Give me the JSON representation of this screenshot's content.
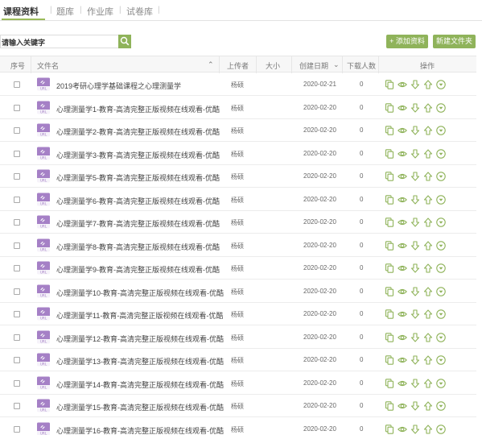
{
  "tabs": [
    {
      "label": "课程资料",
      "active": true
    },
    {
      "label": "题库",
      "active": false
    },
    {
      "label": "作业库",
      "active": false
    },
    {
      "label": "试卷库",
      "active": false
    }
  ],
  "search": {
    "placeholder": "请输入关键字",
    "icon": "search-icon"
  },
  "buttons": {
    "add": "+ 添加资料",
    "new_folder": "新建文件夹"
  },
  "columns": {
    "index": "序号",
    "filename": "文件名",
    "uploader": "上传者",
    "size": "大小",
    "created": "创建日期",
    "downloads": "下载人数",
    "actions": "操作"
  },
  "colors": {
    "accent": "#8fb35a",
    "file_icon": "#a580c6"
  },
  "file_icon_label": "URL",
  "rows": [
    {
      "name": "2019考研心理学基础课程之心理测量学",
      "uploader": "杨硕",
      "date": "2020-02-21",
      "downloads": "0"
    },
    {
      "name": "心理测量学1-教育-高清完整正版视频在线观看-优酷",
      "uploader": "杨硕",
      "date": "2020-02-20",
      "downloads": "0"
    },
    {
      "name": "心理测量学2-教育-高清完整正版视频在线观看-优酷",
      "uploader": "杨硕",
      "date": "2020-02-20",
      "downloads": "0"
    },
    {
      "name": "心理测量学3-教育-高清完整正版视频在线观看-优酷",
      "uploader": "杨硕",
      "date": "2020-02-20",
      "downloads": "0"
    },
    {
      "name": "心理测量学5-教育-高清完整正版视频在线观看-优酷",
      "uploader": "杨硕",
      "date": "2020-02-20",
      "downloads": "0"
    },
    {
      "name": "心理测量学6-教育-高清完整正版视频在线观看-优酷",
      "uploader": "杨硕",
      "date": "2020-02-20",
      "downloads": "0"
    },
    {
      "name": "心理测量学7-教育-高清完整正版视频在线观看-优酷",
      "uploader": "杨硕",
      "date": "2020-02-20",
      "downloads": "0"
    },
    {
      "name": "心理测量学8-教育-高清完整正版视频在线观看-优酷",
      "uploader": "杨硕",
      "date": "2020-02-20",
      "downloads": "0"
    },
    {
      "name": "心理测量学9-教育-高清完整正版视频在线观看-优酷",
      "uploader": "杨硕",
      "date": "2020-02-20",
      "downloads": "0"
    },
    {
      "name": "心理测量学10-教育-高清完整正版视频在线观看-优酷",
      "uploader": "杨硕",
      "date": "2020-02-20",
      "downloads": "0"
    },
    {
      "name": "心理测量学11-教育-高清完整正版视频在线观看-优酷",
      "uploader": "杨硕",
      "date": "2020-02-20",
      "downloads": "0"
    },
    {
      "name": "心理测量学12-教育-高清完整正版视频在线观看-优酷",
      "uploader": "杨硕",
      "date": "2020-02-20",
      "downloads": "0"
    },
    {
      "name": "心理测量学13-教育-高清完整正版视频在线观看-优酷",
      "uploader": "杨硕",
      "date": "2020-02-20",
      "downloads": "0"
    },
    {
      "name": "心理测量学14-教育-高清完整正版视频在线观看-优酷",
      "uploader": "杨硕",
      "date": "2020-02-20",
      "downloads": "0"
    },
    {
      "name": "心理测量学15-教育-高清完整正版视频在线观看-优酷",
      "uploader": "杨硕",
      "date": "2020-02-20",
      "downloads": "0"
    },
    {
      "name": "心理测量学16-教育-高清完整正版视频在线观看-优酷",
      "uploader": "杨硕",
      "date": "2020-02-20",
      "downloads": "0"
    }
  ],
  "row_actions": [
    "copy-icon",
    "preview-eye-icon",
    "move-down-icon",
    "move-up-icon",
    "expand-down-icon"
  ]
}
